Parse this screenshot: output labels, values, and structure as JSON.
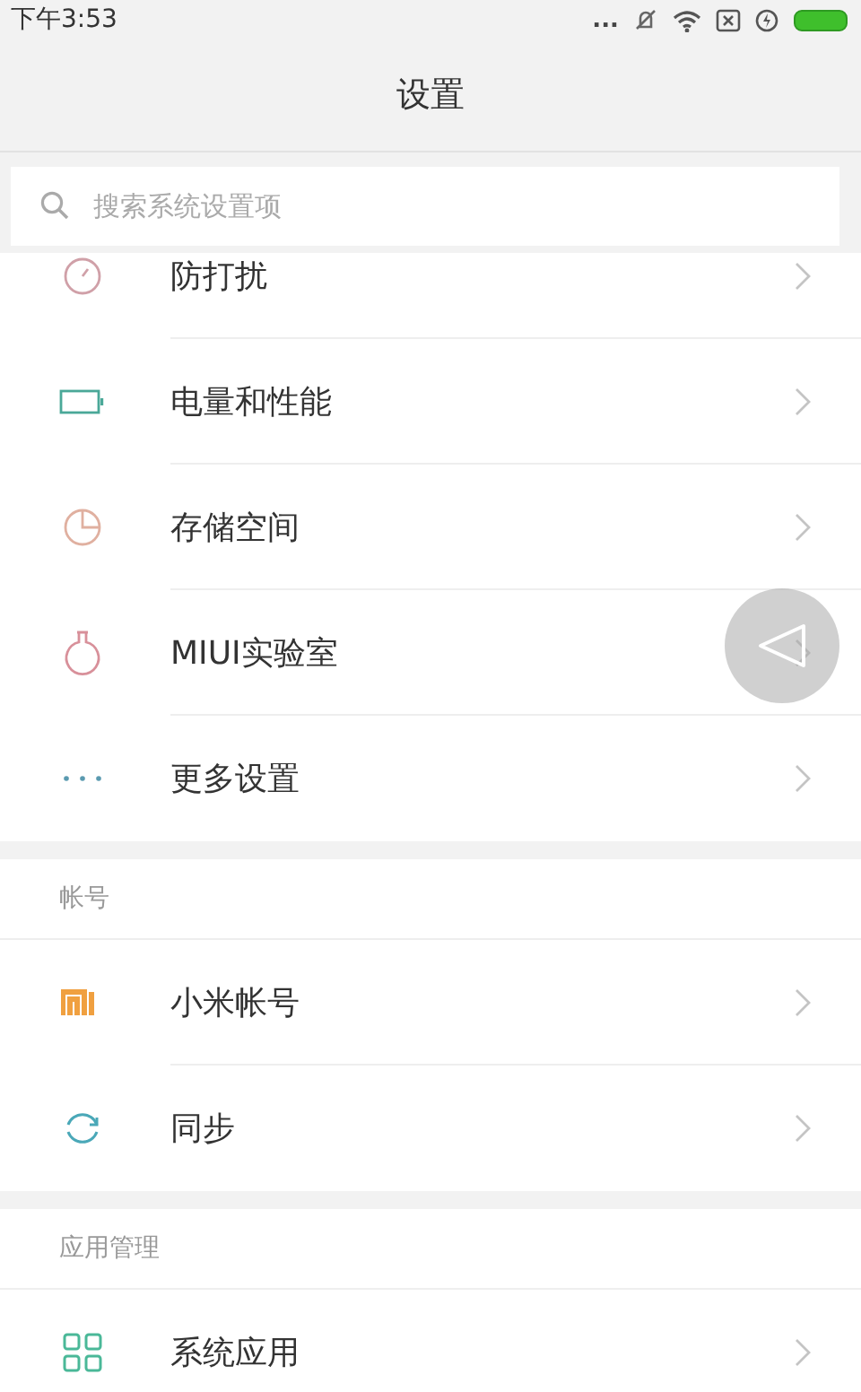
{
  "status_bar": {
    "time": "下午3:53",
    "dots": "..."
  },
  "title": "设置",
  "search": {
    "placeholder": "搜索系统设置项"
  },
  "sections": [
    {
      "items": [
        {
          "label": "防打扰"
        },
        {
          "label": "电量和性能"
        },
        {
          "label": "存储空间"
        },
        {
          "label": "MIUI实验室"
        },
        {
          "label": "更多设置"
        }
      ]
    },
    {
      "header": "帐号",
      "items": [
        {
          "label": "小米帐号"
        },
        {
          "label": "同步"
        }
      ]
    },
    {
      "header": "应用管理",
      "items": [
        {
          "label": "系统应用"
        }
      ]
    }
  ]
}
